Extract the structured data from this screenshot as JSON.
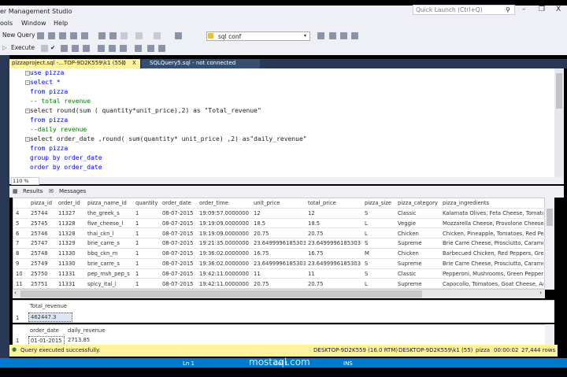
{
  "window": {
    "title": "er Management Studio",
    "quick_launch": "Quick Launch (Ctrl+Q)",
    "minimize": "–",
    "restore": "❐",
    "close": "X"
  },
  "menu": [
    "ools",
    "Window",
    "Help"
  ],
  "toolbar": {
    "new_query": "New Query",
    "execute": "Execute",
    "database": "sql conf"
  },
  "tabs": [
    {
      "label": "pizzaproject.sql -...TOP-9D2K559\\k1 (55))",
      "pin": "⊙",
      "close": "X"
    },
    {
      "label": "SQLQuery5.sql - not connected"
    }
  ],
  "editor": {
    "lines": [
      "use pizza",
      "select *",
      "from pizza",
      "-- total revenue",
      "select round(sum ( quantity*unit_price),2) as \"Total_revenue\"",
      "from pizza",
      "--daily revenue",
      "select order_date ,round( sum(quantity* unit_price) ,2) as\"daily_revenue\"",
      "from pizza",
      "group by order_date",
      "order by order_date"
    ],
    "zoom": "110 %"
  },
  "results_tabs": {
    "results": "Results",
    "messages": "Messages"
  },
  "grid": {
    "columns": [
      "",
      "pizza_id",
      "order_id",
      "pizza_name_id",
      "quantity",
      "order_date",
      "order_time",
      "unit_price",
      "total_price",
      "pizza_size",
      "pizza_category",
      "pizza_ingredients"
    ],
    "rows": [
      [
        "4",
        "25744",
        "11327",
        "the_greek_s",
        "1",
        "08-07-2015",
        "19:09:57.0000000",
        "12",
        "12",
        "S",
        "Classic",
        "Kalamata Olives, Feta Cheese, Tomatoes"
      ],
      [
        "5",
        "25745",
        "11328",
        "five_cheese_l",
        "1",
        "08-07-2015",
        "19:19:09.0000000",
        "18.5",
        "18.5",
        "L",
        "Veggie",
        "Mozzarella Cheese, Provolone Cheese, S"
      ],
      [
        "6",
        "25746",
        "11328",
        "thai_ckn_l",
        "1",
        "08-07-2015",
        "19:19:09.0000000",
        "20.75",
        "20.75",
        "L",
        "Chicken",
        "Chicken, Pineapple, Tomatoes, Red Pepp"
      ],
      [
        "7",
        "25747",
        "11329",
        "brie_carre_s",
        "1",
        "08-07-2015",
        "19:21:35.0000000",
        "23.6499996185303",
        "23.6499996185303",
        "S",
        "Supreme",
        "Brie Carre Cheese, Prosciutto, Carameliz"
      ],
      [
        "8",
        "25748",
        "11330",
        "bbq_ckn_m",
        "1",
        "08-07-2015",
        "19:36:02.0000000",
        "16.75",
        "16.75",
        "M",
        "Chicken",
        "Barbecued Chicken, Red Peppers, Green"
      ],
      [
        "9",
        "25749",
        "11330",
        "brie_carre_s",
        "1",
        "08-07-2015",
        "19:36:02.0000000",
        "23.6499996185303",
        "23.6499996185303",
        "S",
        "Supreme",
        "Brie Carre Cheese, Prosciutto, Carameliz"
      ],
      [
        "10",
        "25750",
        "11331",
        "pep_msh_pep_s",
        "1",
        "08-07-2015",
        "19:42:11.0000000",
        "11",
        "11",
        "S",
        "Classic",
        "Pepperoni, Mushrooms, Green Peppers"
      ],
      [
        "11",
        "25751",
        "11331",
        "spicy_ital_l",
        "1",
        "08-07-2015",
        "19:42:11.0000000",
        "20.75",
        "20.75",
        "L",
        "Supreme",
        "Capocollo, Tomatoes, Goat Cheese, Artic"
      ]
    ]
  },
  "result2": {
    "column": "Total_revenue",
    "row": "1",
    "value": "462447.3"
  },
  "result3": {
    "columns": [
      "order_date",
      "daily_revenue"
    ],
    "row": "1",
    "values": [
      "01-01-2015",
      "2713.85"
    ]
  },
  "status": {
    "message": "Query executed successfully.",
    "server": "DESKTOP-9D2K559 (16.0 RTM)",
    "user": "DESKTOP-9D2K559\\k1 (55)",
    "db": "pizza",
    "time": "00:00:02",
    "rows": "27,444 rows"
  },
  "bottombar": {
    "ln": "Ln 1",
    "col": "Col 1",
    "ins": "INS"
  },
  "watermark": "mostaql.com"
}
